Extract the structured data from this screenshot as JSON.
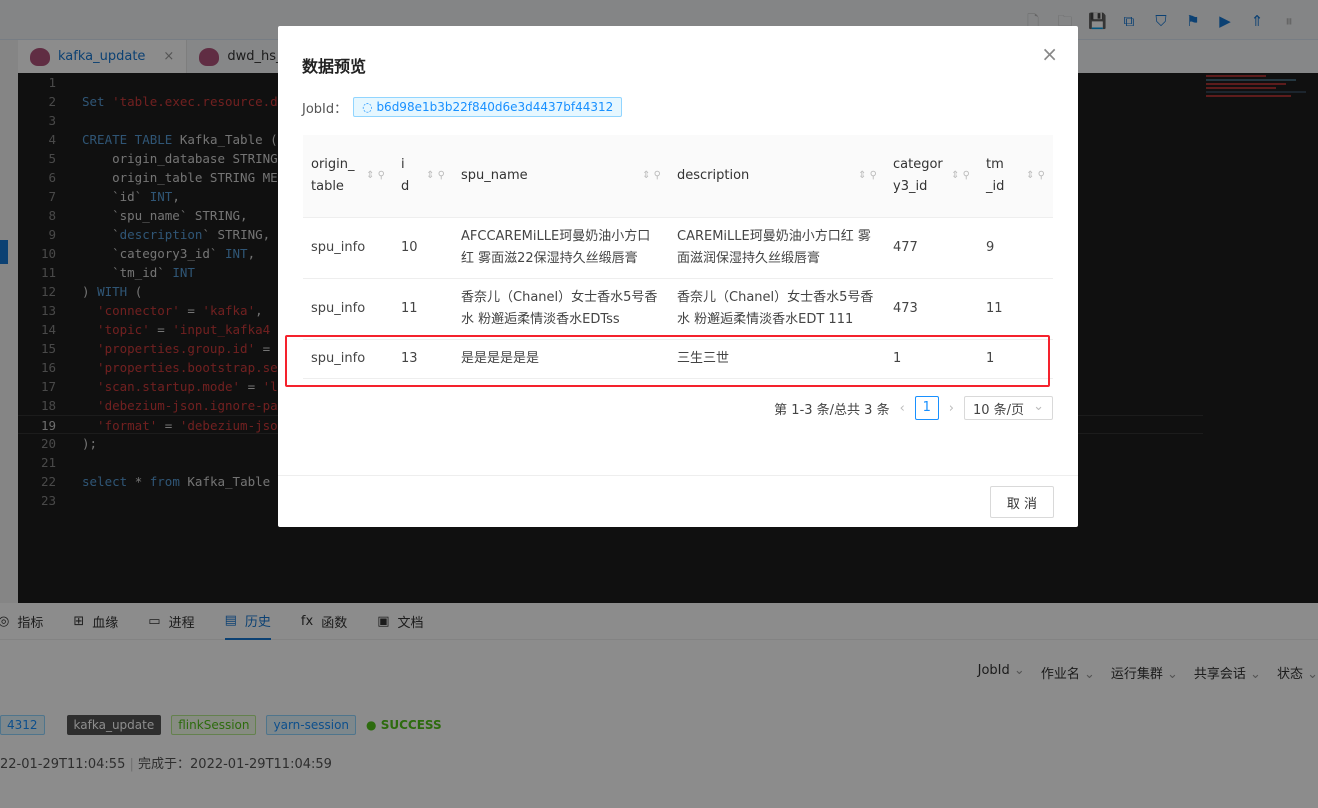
{
  "toolbar": {
    "icons": [
      "new-file-icon",
      "open-folder-icon",
      "save-icon",
      "copy-icon",
      "check-shield-icon",
      "flag-icon",
      "play-icon",
      "rocket-icon",
      "pause-icon"
    ]
  },
  "tabs": [
    {
      "label": "kafka_update",
      "close": "×"
    },
    {
      "label": "dwd_hs_p"
    }
  ],
  "editor": {
    "lines": [
      [],
      [
        [
          "k",
          "Set "
        ],
        [
          "s",
          "'table.exec.resource.d"
        ]
      ],
      [],
      [
        [
          "k",
          "CREATE TABLE "
        ],
        [
          "p",
          "Kafka_Table ("
        ]
      ],
      [
        [
          "p",
          "    origin_database STRING"
        ]
      ],
      [
        [
          "p",
          "    origin_table STRING ME"
        ]
      ],
      [
        [
          "p",
          "    `id` "
        ],
        [
          "k",
          "INT"
        ],
        [
          "p",
          ","
        ]
      ],
      [
        [
          "p",
          "    `spu_name` STRING,"
        ]
      ],
      [
        [
          "p",
          "    `"
        ],
        [
          "k",
          "description"
        ],
        [
          "p",
          "` STRING,"
        ]
      ],
      [
        [
          "p",
          "    `category3_id` "
        ],
        [
          "k",
          "INT"
        ],
        [
          "p",
          ","
        ]
      ],
      [
        [
          "p",
          "    `tm_id` "
        ],
        [
          "k",
          "INT"
        ]
      ],
      [
        [
          "p",
          ") "
        ],
        [
          "k",
          "WITH"
        ],
        [
          "p",
          " ("
        ]
      ],
      [
        [
          "s",
          "  'connector'"
        ],
        [
          "p",
          " = "
        ],
        [
          "s",
          "'kafka'"
        ],
        [
          "p",
          ","
        ]
      ],
      [
        [
          "s",
          "  'topic'"
        ],
        [
          "p",
          " = "
        ],
        [
          "s",
          "'input_kafka4"
        ]
      ],
      [
        [
          "s",
          "  'properties.group.id'"
        ],
        [
          "p",
          " ="
        ]
      ],
      [
        [
          "s",
          "  'properties.bootstrap.se"
        ]
      ],
      [
        [
          "s",
          "  'scan.startup.mode'"
        ],
        [
          "p",
          " = "
        ],
        [
          "s",
          "'l"
        ]
      ],
      [
        [
          "s",
          "  'debezium-json.ignore-pa"
        ]
      ],
      [
        [
          "s",
          "  'format'"
        ],
        [
          "p",
          " = "
        ],
        [
          "s",
          "'debezium-jso"
        ]
      ],
      [
        [
          "p",
          ");"
        ]
      ],
      [],
      [
        [
          "k",
          "select "
        ],
        [
          "p",
          "* "
        ],
        [
          "k",
          "from "
        ],
        [
          "p",
          "Kafka_Table"
        ]
      ],
      []
    ],
    "current_line": 19
  },
  "bottom": {
    "tabs": [
      {
        "label": "指标",
        "icon": "dashboard-icon"
      },
      {
        "label": "血缘",
        "icon": "lineage-icon"
      },
      {
        "label": "进程",
        "icon": "monitor-icon"
      },
      {
        "label": "历史",
        "icon": "calendar-icon",
        "active": true
      },
      {
        "label": "函数",
        "icon": "function-icon"
      },
      {
        "label": "文档",
        "icon": "document-icon"
      }
    ],
    "filters": [
      "JobId",
      "作业名",
      "运行集群",
      "共享会话",
      "状态"
    ],
    "tags": {
      "jobid": "4312",
      "job": "kafka_update",
      "session": "flinkSession",
      "cluster": "yarn-session",
      "status": "SUCCESS"
    },
    "start": "22-01-29T11:04:55",
    "end_label": "完成于：",
    "end": "2022-01-29T11:04:59"
  },
  "modal": {
    "title": "数据预览",
    "close": "×",
    "jobid_label": "JobId：",
    "jobid": "b6d98e1b3b22f840d6e3d4437bf44312",
    "columns": [
      "origin_table",
      "id",
      "spu_name",
      "description",
      "category3_id",
      "tm_id"
    ],
    "rows": [
      [
        "spu_info",
        "10",
        "AFCCAREMiLLE珂曼奶油小方口红 雾面滋22保湿持久丝缎唇膏",
        "CAREMiLLE珂曼奶油小方口红 雾面滋润保湿持久丝缎唇膏",
        "477",
        "9"
      ],
      [
        "spu_info",
        "11",
        "香奈儿（Chanel）女士香水5号香水 粉邂逅柔情淡香水EDTss",
        "香奈儿（Chanel）女士香水5号香水 粉邂逅柔情淡香水EDT 111",
        "473",
        "11"
      ],
      [
        "spu_info",
        "13",
        "是是是是是是",
        "三生三世",
        "1",
        "1"
      ]
    ],
    "highlighted_row": 3,
    "pagination": {
      "summary": "第 1-3 条/总共 3 条",
      "current": "1",
      "page_size": "10 条/页"
    },
    "cancel": "取 消"
  }
}
